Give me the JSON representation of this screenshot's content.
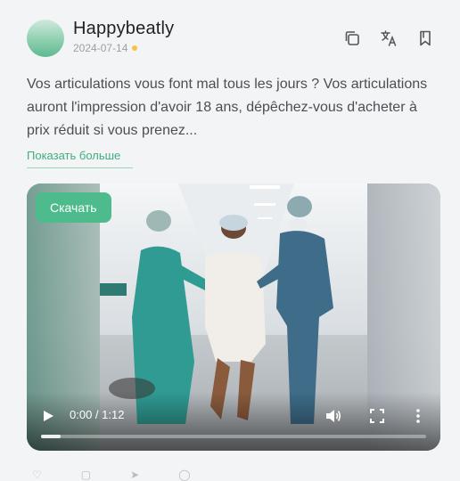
{
  "post": {
    "author": "Happybeatly",
    "date": "2024-07-14",
    "text": "Vos articulations vous font mal tous les jours ? Vos articulations auront l'impression d'avoir 18 ans, dépêchez-vous d'acheter à prix réduit si vous prenez...",
    "show_more": "Показать больше"
  },
  "actions": {
    "icons": [
      "copy-icon",
      "translate-icon",
      "bookmark-icon"
    ]
  },
  "video": {
    "download_label": "Скачать",
    "time": "0:00 / 1:12",
    "progress": 0.05
  },
  "colors": {
    "accent": "#4ebb8d",
    "status_dot": "#f6c244"
  }
}
